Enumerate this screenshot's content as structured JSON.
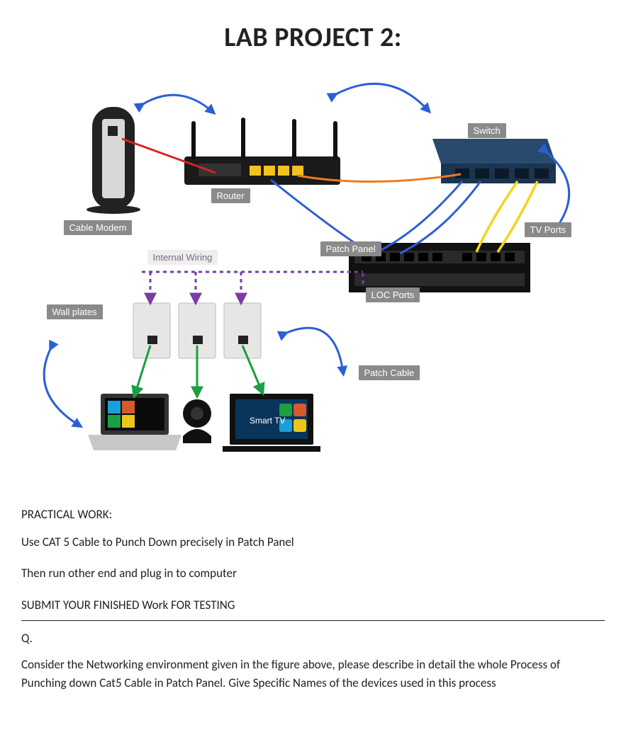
{
  "title": "LAB PROJECT 2:",
  "diagram": {
    "labels": {
      "cable_modem": "Cable Modem",
      "router": "Router",
      "switch": "Switch",
      "tv_ports": "TV Ports",
      "patch_panel": "Patch Panel",
      "loc_ports": "LOC Ports",
      "internal_wiring": "Internal Wiring",
      "wall_plates": "Wall plates",
      "patch_cable": "Patch Cable",
      "smart_tv": "Smart TV"
    }
  },
  "practical": {
    "heading": "PRACTICAL WORK:",
    "line1": "Use CAT 5 Cable to Punch Down precisely in Patch Panel",
    "line2": "Then run other end and plug in to computer",
    "submit": "SUBMIT YOUR FINISHED Work FOR TESTING"
  },
  "question": {
    "q_label": "Q.",
    "prompt": "Consider the Networking environment given in the figure above, please describe in detail the whole Process of Punching down Cat5 Cable in Patch Panel. Give Specific Names of the devices used in this process"
  }
}
